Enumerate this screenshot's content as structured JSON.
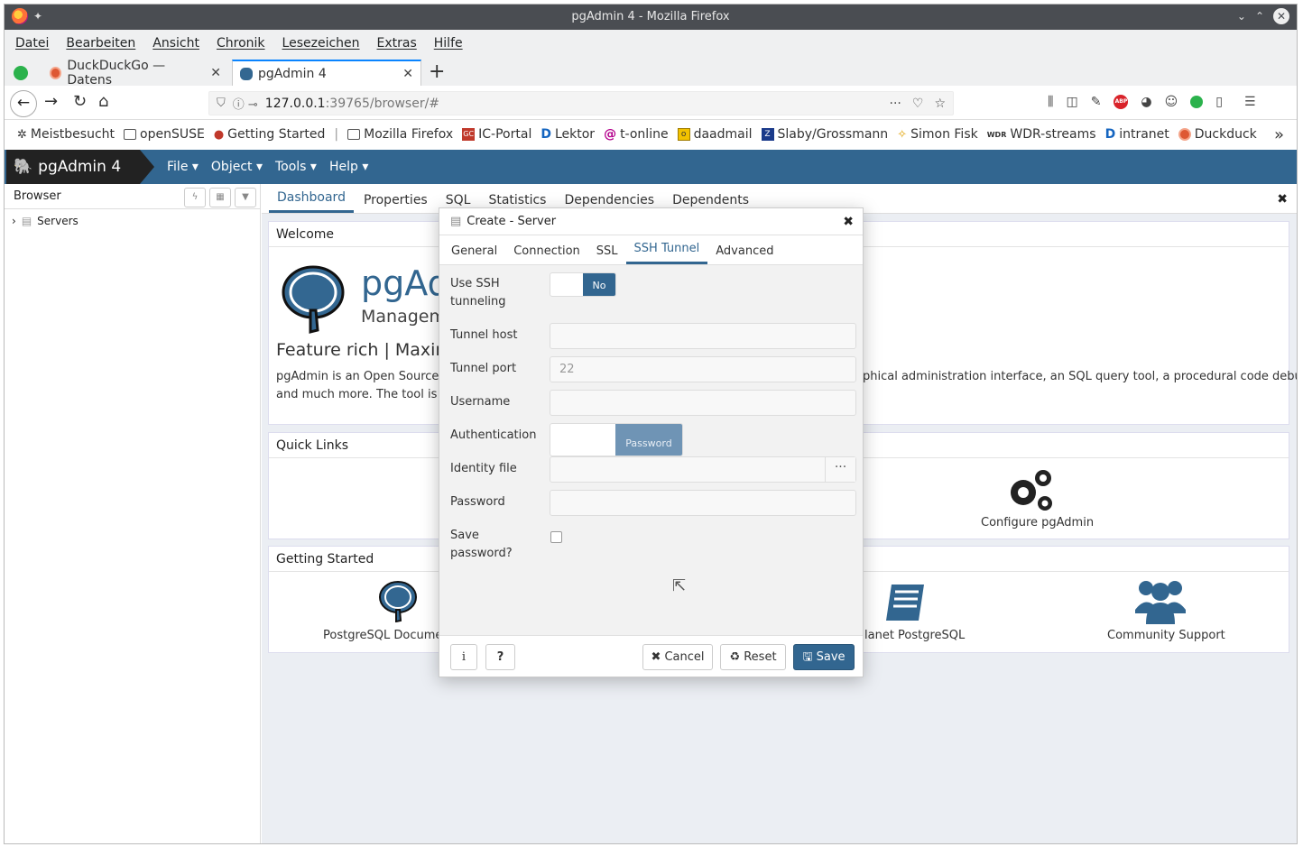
{
  "window": {
    "title": "pgAdmin 4 - Mozilla Firefox"
  },
  "menubar": [
    "Datei",
    "Bearbeiten",
    "Ansicht",
    "Chronik",
    "Lesezeichen",
    "Extras",
    "Hilfe"
  ],
  "tabs": [
    {
      "label": "DuckDuckGo — Datens"
    },
    {
      "label": "pgAdmin 4"
    }
  ],
  "url": {
    "host": "127.0.0.1",
    "path": ":39765/browser/#"
  },
  "bookmarks": [
    {
      "label": "Meistbesucht",
      "icon": "gear-icon"
    },
    {
      "label": "openSUSE",
      "icon": "folder-icon"
    },
    {
      "label": "Getting Started",
      "icon": "firefox-icon"
    },
    {
      "label": "Mozilla Firefox",
      "icon": "folder-icon"
    },
    {
      "label": "IC-Portal",
      "icon": "gc-icon"
    },
    {
      "label": "Lektor",
      "icon": "d-icon"
    },
    {
      "label": "t-online",
      "icon": "at-icon"
    },
    {
      "label": "daadmail",
      "icon": "mail-icon"
    },
    {
      "label": "Slaby/Grossmann",
      "icon": "z-icon"
    },
    {
      "label": "Simon Fisk",
      "icon": "star-icon"
    },
    {
      "label": "WDR-streams",
      "icon": "wdr-icon"
    },
    {
      "label": "intranet",
      "icon": "d-icon"
    },
    {
      "label": "Duckduck",
      "icon": "duckduckgo-icon"
    }
  ],
  "pgadmin": {
    "brand": "pgAdmin 4",
    "menu": [
      "File ▾",
      "Object ▾",
      "Tools ▾",
      "Help ▾"
    ]
  },
  "browser_panel": {
    "title": "Browser",
    "tree_root": "Servers"
  },
  "main_tabs": [
    "Dashboard",
    "Properties",
    "SQL",
    "Statistics",
    "Dependencies",
    "Dependents"
  ],
  "welcome": {
    "header": "Welcome",
    "logo_text": "pgAd",
    "subtitle": "Manageme",
    "feature": "Feature rich | Maxim",
    "desc_line1": "pgAdmin is an Open Source ad",
    "desc_line2": "and much more. The tool is des",
    "desc_right": "phical administration interface, an SQL query tool, a procedural code debugger"
  },
  "quick_links": {
    "header": "Quick Links",
    "configure": "Configure pgAdmin"
  },
  "getting_started": {
    "header": "Getting Started",
    "items": [
      "PostgreSQL Documen",
      "lanet PostgreSQL",
      "Community Support"
    ]
  },
  "dialog": {
    "title": "Create - Server",
    "tabs": [
      "General",
      "Connection",
      "SSL",
      "SSH Tunnel",
      "Advanced"
    ],
    "fields": {
      "use_ssh_label_1": "Use SSH",
      "use_ssh_label_2": "tunneling",
      "use_ssh_value": "No",
      "tunnel_host_label": "Tunnel host",
      "tunnel_host_value": "",
      "tunnel_port_label": "Tunnel port",
      "tunnel_port_value": "22",
      "username_label": "Username",
      "username_value": "",
      "auth_label": "Authentication",
      "auth_value": "Password",
      "identity_label": "Identity file",
      "identity_button": "···",
      "password_label": "Password",
      "save_pw_label_1": "Save",
      "save_pw_label_2": "password?"
    },
    "footer": {
      "info": "i",
      "help": "?",
      "cancel": "✖ Cancel",
      "reset": "♻ Reset",
      "save": "🖫 Save"
    }
  }
}
